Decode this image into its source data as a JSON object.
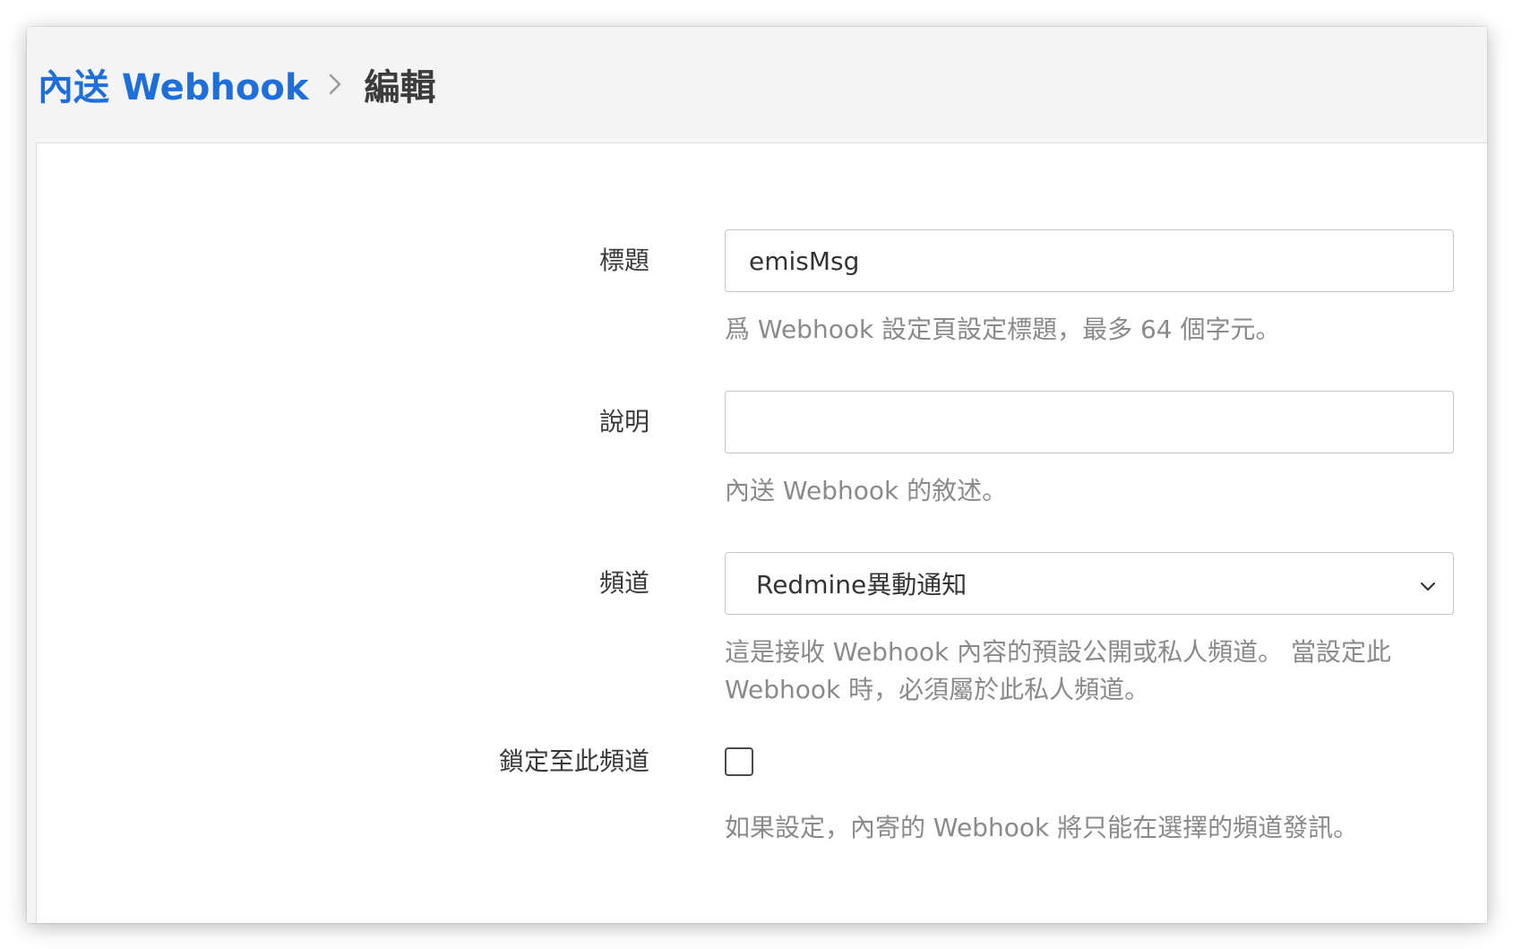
{
  "breadcrumb": {
    "parent": "內送 Webhook",
    "current": "編輯"
  },
  "form": {
    "title": {
      "label": "標題",
      "value": "emisMsg",
      "help": "爲 Webhook 設定頁設定標題，最多 64 個字元。"
    },
    "description": {
      "label": "說明",
      "value": "",
      "help": "內送 Webhook 的敘述。"
    },
    "channel": {
      "label": "頻道",
      "selected": "Redmine異動通知",
      "help_line1": "這是接收 Webhook 內容的預設公開或私人頻道。 當設定此",
      "help_line2": "Webhook 時，必須屬於此私人頻道。"
    },
    "lock": {
      "label": "鎖定至此頻道",
      "checked": false,
      "help": "如果設定，內寄的 Webhook 將只能在選擇的頻道發訊。"
    }
  },
  "colors": {
    "link": "#1e6fd9",
    "help_text": "#8a8a8a",
    "header_bg": "#f4f4f4"
  },
  "icons": {
    "breadcrumb_separator": "chevron-right-icon",
    "select_arrow": "chevron-down-icon"
  }
}
